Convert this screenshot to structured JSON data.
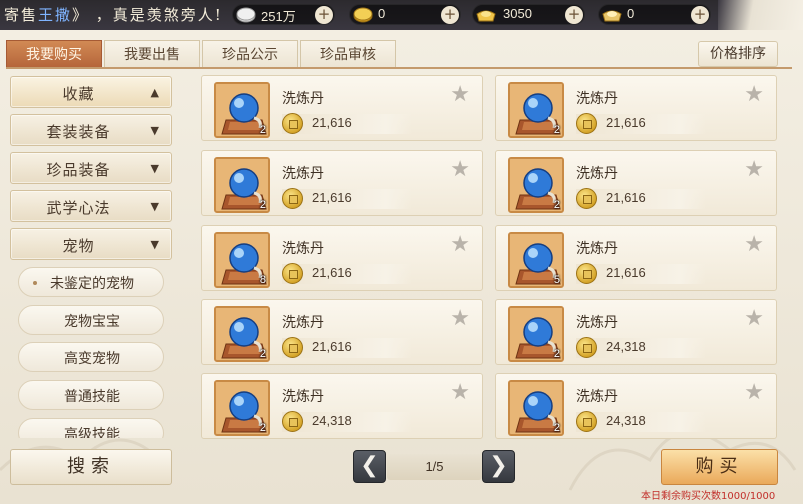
{
  "topbar": {
    "marquee_prefix": "寄售",
    "marquee_name": "王撒",
    "marquee_suffix": "》 ，真是羡煞旁人!",
    "resources": [
      {
        "icon": "silver-coin-icon",
        "value": "251万"
      },
      {
        "icon": "gold-coin-icon",
        "value": "0"
      },
      {
        "icon": "gold-ingot-icon",
        "value": "3050"
      },
      {
        "icon": "silver-ingot-icon",
        "value": "0"
      }
    ]
  },
  "tabs": [
    {
      "label": "我要购买",
      "active": true
    },
    {
      "label": "我要出售",
      "active": false
    },
    {
      "label": "珍品公示",
      "active": false
    },
    {
      "label": "珍品审核",
      "active": false
    }
  ],
  "sort_label": "价格排序",
  "sidebar": {
    "categories": [
      {
        "label": "收藏",
        "arrow": "▲"
      },
      {
        "label": "套装装备",
        "arrow": "▼"
      },
      {
        "label": "珍品装备",
        "arrow": "▼"
      },
      {
        "label": "武学心法",
        "arrow": "▼"
      },
      {
        "label": "宠物",
        "arrow": "▼"
      }
    ],
    "subitems": [
      {
        "label": "未鉴定的宠物"
      },
      {
        "label": "宠物宝宝"
      },
      {
        "label": "高变宠物"
      },
      {
        "label": "普通技能"
      },
      {
        "label": "高级技能"
      }
    ]
  },
  "items": [
    {
      "name": "洗炼丹",
      "count": "2",
      "price": "21,616",
      "icon": "blue-orb-icon"
    },
    {
      "name": "洗炼丹",
      "count": "2",
      "price": "21,616",
      "icon": "blue-orb-icon"
    },
    {
      "name": "洗炼丹",
      "count": "2",
      "price": "21,616",
      "icon": "blue-orb-icon"
    },
    {
      "name": "洗炼丹",
      "count": "2",
      "price": "21,616",
      "icon": "blue-orb-icon"
    },
    {
      "name": "洗炼丹",
      "count": "8",
      "price": "21,616",
      "icon": "blue-orb-icon"
    },
    {
      "name": "洗炼丹",
      "count": "5",
      "price": "21,616",
      "icon": "blue-orb-icon"
    },
    {
      "name": "洗炼丹",
      "count": "2",
      "price": "21,616",
      "icon": "blue-orb-icon"
    },
    {
      "name": "洗炼丹",
      "count": "2",
      "price": "24,318",
      "icon": "blue-orb-icon"
    },
    {
      "name": "洗炼丹",
      "count": "2",
      "price": "24,318",
      "icon": "blue-orb-icon"
    },
    {
      "name": "洗炼丹",
      "count": "2",
      "price": "24,318",
      "icon": "blue-orb-icon"
    }
  ],
  "search_label": "搜索",
  "pagination": {
    "prev": "❮",
    "next": "❯",
    "text": "1/5"
  },
  "buy_label": "购买",
  "buy_note": "本日剩余购买次数1000/1000"
}
